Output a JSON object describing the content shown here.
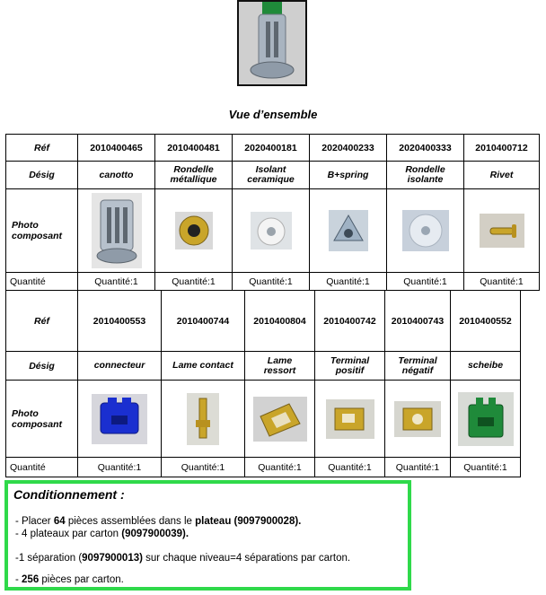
{
  "header": {
    "title": "Vue d’ensemble"
  },
  "labels": {
    "ref": "Réf",
    "desig": "Désig",
    "photo_line1": "Photo",
    "photo_line2": "composant",
    "quantite": "Quantité"
  },
  "table1": {
    "items": [
      {
        "ref": "2010400465",
        "desig": "canotto",
        "desig2": "",
        "qty": "Quantité:1",
        "photo_icon": "hollow-tube-part-icon"
      },
      {
        "ref": "2010400481",
        "desig": "Rondelle",
        "desig2": "métallique",
        "qty": "Quantité:1",
        "photo_icon": "metal-washer-icon"
      },
      {
        "ref": "2020400181",
        "desig": "Isolant",
        "desig2": "ceramique",
        "qty": "Quantité:1",
        "photo_icon": "ceramic-insulator-icon"
      },
      {
        "ref": "2020400233",
        "desig": "B+spring",
        "desig2": "",
        "qty": "Quantité:1",
        "photo_icon": "spring-clip-icon"
      },
      {
        "ref": "2020400333",
        "desig": "Rondelle",
        "desig2": "isolante",
        "qty": "Quantité:1",
        "photo_icon": "insulating-washer-icon"
      },
      {
        "ref": "2010400712",
        "desig": "Rivet",
        "desig2": "",
        "qty": "Quantité:1",
        "photo_icon": "rivet-icon"
      }
    ]
  },
  "table2": {
    "items": [
      {
        "ref": "2010400553",
        "desig": "connecteur",
        "desig2": "",
        "qty": "Quantité:1",
        "photo_icon": "connector-icon"
      },
      {
        "ref": "2010400744",
        "desig": "Lame contact",
        "desig2": "",
        "qty": "Quantité:1",
        "photo_icon": "contact-blade-icon"
      },
      {
        "ref": "2010400804",
        "desig": "Lame",
        "desig2": "ressort",
        "qty": "Quantité:1",
        "photo_icon": "spring-blade-icon"
      },
      {
        "ref": "2010400742",
        "desig": "Terminal",
        "desig2": "positif",
        "qty": "Quantité:1",
        "photo_icon": "positive-terminal-icon"
      },
      {
        "ref": "2010400743",
        "desig": "Terminal",
        "desig2": "négatif",
        "qty": "Quantité:1",
        "photo_icon": "negative-terminal-icon"
      },
      {
        "ref": "2010400552",
        "desig": "scheibe",
        "desig2": "",
        "qty": "Quantité:1",
        "photo_icon": "scheibe-part-icon"
      }
    ]
  },
  "conditionnement": {
    "title": "Conditionnement :",
    "line1_pre": "- Placer ",
    "line1_qty": "64",
    "line1_mid": " pièces assemblées dans le ",
    "line1_plateau": "plateau",
    "line1_code": " (9097900028).",
    "line2_pre": "- 4 plateaux par carton ",
    "line2_code": "(9097900039).",
    "line3_pre": "-1 séparation (",
    "line3_code": "9097900013)",
    "line3_post": " sur chaque niveau=4 séparations par carton.",
    "line4_pre": "- ",
    "line4_qty": "256",
    "line4_post": " pièces par carton."
  },
  "colors": {
    "highlight_border": "#2fd94a",
    "connector_blue": "#1a2fd0",
    "brass": "#c9a52a",
    "green_part": "#1f8a3a"
  }
}
